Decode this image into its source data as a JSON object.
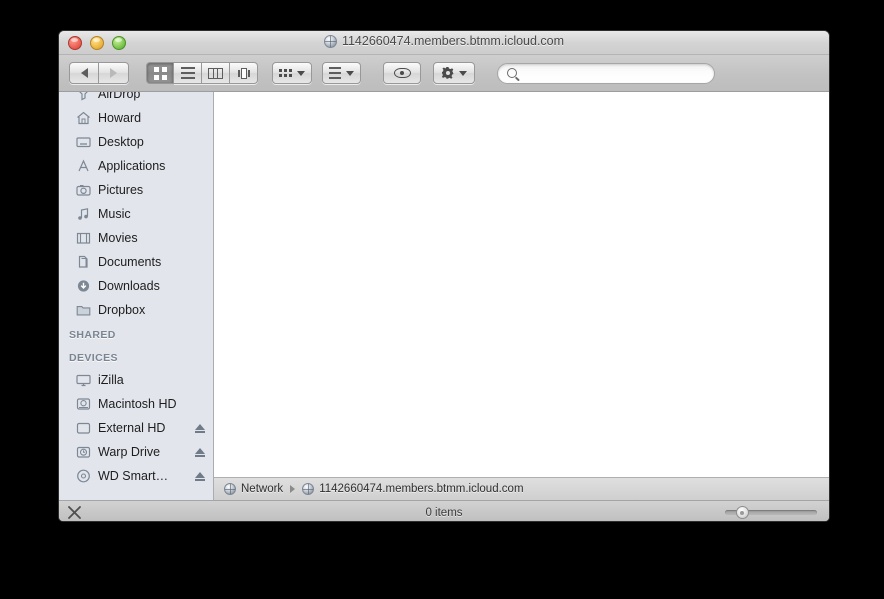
{
  "window": {
    "title": "1142660474.members.btmm.icloud.com",
    "title_icon": "globe-icon"
  },
  "traffic_lights": {
    "close": "close-button",
    "minimize": "minimize-button",
    "zoom": "zoom-button"
  },
  "toolbar": {
    "back_label": "Back",
    "forward_label": "Forward",
    "views": [
      {
        "name": "icon-view",
        "label": "Icon View",
        "active": true
      },
      {
        "name": "list-view",
        "label": "List View",
        "active": false
      },
      {
        "name": "column-view",
        "label": "Column View",
        "active": false
      },
      {
        "name": "coverflow-view",
        "label": "Cover Flow View",
        "active": false
      }
    ],
    "arrange_label": "Arrange By",
    "action_label": "Action",
    "quicklook_label": "Quick Look",
    "search": {
      "placeholder": "",
      "value": ""
    }
  },
  "sidebar": {
    "favorites": [
      {
        "label": "AirDrop",
        "icon": "airdrop-icon"
      },
      {
        "label": "Howard",
        "icon": "home-icon"
      },
      {
        "label": "Desktop",
        "icon": "desktop-icon"
      },
      {
        "label": "Applications",
        "icon": "applications-icon"
      },
      {
        "label": "Pictures",
        "icon": "pictures-icon"
      },
      {
        "label": "Music",
        "icon": "music-icon"
      },
      {
        "label": "Movies",
        "icon": "movies-icon"
      },
      {
        "label": "Documents",
        "icon": "documents-icon"
      },
      {
        "label": "Downloads",
        "icon": "downloads-icon"
      },
      {
        "label": "Dropbox",
        "icon": "folder-icon"
      }
    ],
    "shared_header": "SHARED",
    "devices_header": "DEVICES",
    "devices": [
      {
        "label": "iZilla",
        "icon": "computer-icon",
        "eject": false
      },
      {
        "label": "Macintosh HD",
        "icon": "internal-drive-icon",
        "eject": false
      },
      {
        "label": "External HD",
        "icon": "external-drive-icon",
        "eject": true
      },
      {
        "label": "Warp Drive",
        "icon": "time-machine-drive-icon",
        "eject": true
      },
      {
        "label": "WD Smart…",
        "icon": "disc-icon",
        "eject": true
      }
    ]
  },
  "pathbar": {
    "segments": [
      {
        "label": "Network",
        "icon": "globe-icon"
      },
      {
        "label": "1142660474.members.btmm.icloud.com",
        "icon": "globe-icon"
      }
    ]
  },
  "statusbar": {
    "disconnect_label": "Disconnect",
    "item_count": "0 items",
    "zoom_slider_value": "18"
  },
  "colors": {
    "sidebar_bg": "#e2e6ec",
    "content_bg": "#ffffff",
    "chrome": "#c2c2c2",
    "desktop_bg": "#000000"
  }
}
